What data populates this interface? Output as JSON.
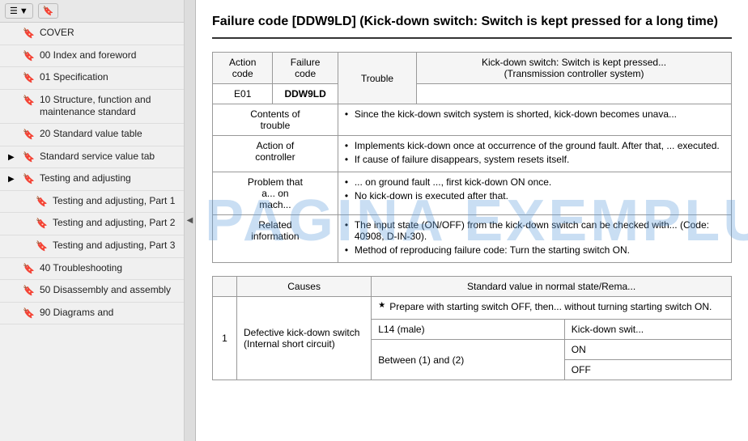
{
  "sidebar": {
    "toolbar": {
      "menu_icon": "☰",
      "bookmark_icon": "🔖"
    },
    "items": [
      {
        "id": "cover",
        "label": "COVER",
        "indent": 0,
        "expandable": false
      },
      {
        "id": "00-index",
        "label": "00 Index and foreword",
        "indent": 0,
        "expandable": false
      },
      {
        "id": "01-spec",
        "label": "01 Specification",
        "indent": 0,
        "expandable": false
      },
      {
        "id": "10-structure",
        "label": "10 Structure, function and maintenance standard",
        "indent": 0,
        "expandable": false
      },
      {
        "id": "20-standard",
        "label": "20 Standard value table",
        "indent": 0,
        "expandable": false
      },
      {
        "id": "standard-service",
        "label": "Standard service value tab",
        "indent": 0,
        "expandable": true
      },
      {
        "id": "testing-adj",
        "label": "Testing and adjusting",
        "indent": 0,
        "expandable": true
      },
      {
        "id": "testing-adj-1",
        "label": "Testing and adjusting, Part 1",
        "indent": 1,
        "expandable": false
      },
      {
        "id": "testing-adj-2",
        "label": "Testing and adjusting, Part 2",
        "indent": 1,
        "expandable": false
      },
      {
        "id": "testing-adj-3",
        "label": "Testing and adjusting, Part 3",
        "indent": 1,
        "expandable": false
      },
      {
        "id": "40-trouble",
        "label": "40 Troubleshooting",
        "indent": 0,
        "expandable": false
      },
      {
        "id": "50-disassembly",
        "label": "50 Disassembly and assembly",
        "indent": 0,
        "expandable": false
      },
      {
        "id": "90-diagrams",
        "label": "90 Diagrams and",
        "indent": 0,
        "expandable": false
      }
    ]
  },
  "main": {
    "title": "Failure code [DDW9LD] (Kick-down switch: Switch is ke... long time)",
    "title_full": "Failure code [DDW9LD] (Kick-down switch: Switch is kept pressed for a long time)",
    "top_table": {
      "headers": [
        "Action code",
        "Failure code",
        "Trouble"
      ],
      "action_code": "E01",
      "failure_code": "DDW9LD",
      "trouble_label": "Trouble",
      "trouble_desc": "Kick-down switch: Switch is kept pressed... (Transmission controller system)",
      "rows": [
        {
          "label": "Contents of trouble",
          "content": "Since the kick-down switch system is shorted, kick-down becomes unava..."
        },
        {
          "label": "Action of controller",
          "bullets": [
            "Implements kick-down once at occurrence of the ground fault. After that, ... executed.",
            "If cause of failure disappears, system resets itself."
          ]
        },
        {
          "label": "Problem that action on machine",
          "bullets": [
            "... on ground fault ..., first kick-down ON once.",
            "No kick-down is executed after that."
          ]
        },
        {
          "label": "Related information",
          "bullets": [
            "The input state (ON/OFF) from the kick-down switch can be checked with... (Code: 40908, D-IN-30).",
            "Method of reproducing failure code: Turn the starting switch ON."
          ]
        }
      ]
    },
    "causes_table": {
      "headers": [
        "Causes",
        "Standard value in normal state/Rema..."
      ],
      "rows": [
        {
          "num": "1",
          "cause": "Defective kick-down switch (Internal short circuit)",
          "standard_header": "★ Prepare with starting switch OFF, then... without turning starting switch ON.",
          "sub_rows": [
            {
              "label": "L14 (male)",
              "col": "Kick-down swit..."
            },
            {
              "label": "",
              "col": "ON"
            },
            {
              "label": "Between (1) and (2)",
              "col": ""
            },
            {
              "label": "",
              "col": "OFF"
            }
          ]
        }
      ]
    }
  },
  "watermark": "PAGINA EXEMPLU"
}
